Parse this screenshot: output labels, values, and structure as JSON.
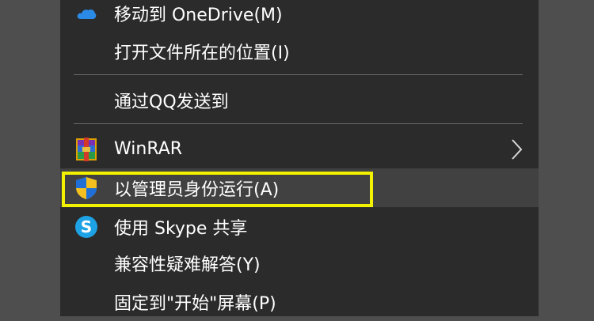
{
  "menu": {
    "items": [
      {
        "label": "移动到 OneDrive(M)",
        "icon": "onedrive-cloud-icon"
      },
      {
        "label": "打开文件所在的位置(I)",
        "icon": ""
      },
      {
        "label": "通过QQ发送到",
        "icon": ""
      },
      {
        "label": "WinRAR",
        "icon": "winrar-icon",
        "submenu": true
      },
      {
        "label": "以管理员身份运行(A)",
        "icon": "uac-shield-icon",
        "hovered": true
      },
      {
        "label": "使用 Skype 共享",
        "icon": "skype-icon"
      },
      {
        "label": "兼容性疑难解答(Y)",
        "icon": ""
      },
      {
        "label": "固定到\"开始\"屏幕(P)",
        "icon": ""
      }
    ]
  },
  "colors": {
    "menu_background": "#2b2b2b",
    "hover_background": "#414141",
    "highlight_border": "#f2f200",
    "outside_background": "#4e4e4e"
  }
}
